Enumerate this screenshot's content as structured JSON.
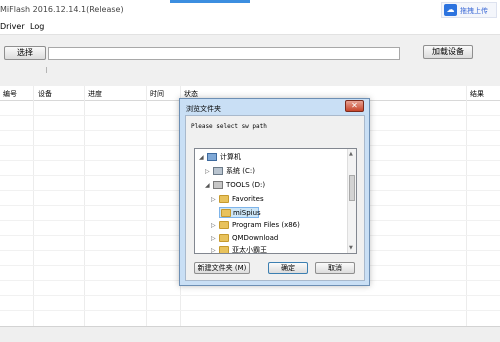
{
  "app": {
    "title": "MiFlash 2016.12.14.1(Release)"
  },
  "cloud_button": {
    "label": "拖拽上传",
    "icon": "cloud-upload-icon"
  },
  "menu": {
    "items": [
      "Driver",
      "Log"
    ]
  },
  "toolbar": {
    "select_label": "选择",
    "load_device_label": "加载设备",
    "path_value": ""
  },
  "grid": {
    "columns": [
      "编号",
      "设备",
      "进度",
      "时间",
      "状态",
      "结果"
    ]
  },
  "dialog": {
    "title": "浏览文件夹",
    "close_icon": "close-icon",
    "message": "Please select sw path",
    "tree": [
      {
        "label": "计算机",
        "icon": "computer-icon",
        "expanded": true
      },
      {
        "label": "系统 (C:)",
        "icon": "drive-icon",
        "expanded": false
      },
      {
        "label": "TOOLS (D:)",
        "icon": "drive-icon",
        "expanded": true
      },
      {
        "label": "Favorites",
        "icon": "folder-icon",
        "expanded": false
      },
      {
        "label": "miSpius",
        "icon": "folder-icon",
        "expanded": false,
        "selected": true
      },
      {
        "label": "Program Files (x86)",
        "icon": "folder-icon",
        "expanded": false
      },
      {
        "label": "QMDownload",
        "icon": "folder-icon",
        "expanded": false
      },
      {
        "label": "亚太小霸王",
        "icon": "folder-icon",
        "expanded": false
      }
    ],
    "new_folder_label": "新建文件夹 (M)",
    "ok_label": "确定",
    "cancel_label": "取消"
  }
}
